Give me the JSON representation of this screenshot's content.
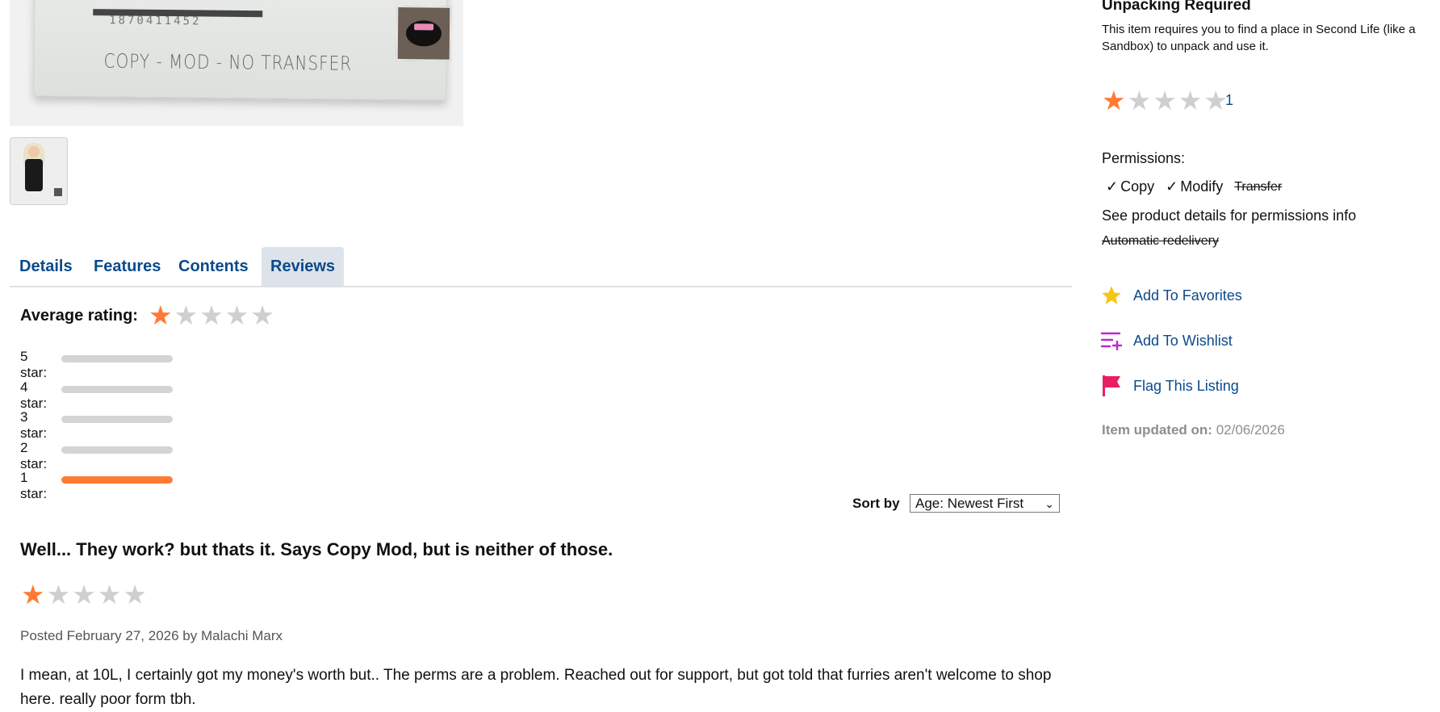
{
  "product_image": {
    "barcode_text": "1870411452",
    "label_text": "COPY - MOD - NO TRANSFER"
  },
  "tabs": [
    {
      "label": "Details"
    },
    {
      "label": "Features"
    },
    {
      "label": "Contents"
    },
    {
      "label": "Reviews",
      "active": true
    }
  ],
  "average_rating": {
    "label": "Average rating:",
    "stars_filled": 1,
    "stars_total": 5
  },
  "distribution": [
    {
      "label": "5 star:",
      "fraction": 0
    },
    {
      "label": "4 star:",
      "fraction": 0
    },
    {
      "label": "3 star:",
      "fraction": 0
    },
    {
      "label": "2 star:",
      "fraction": 0
    },
    {
      "label": "1 star:",
      "fraction": 1
    }
  ],
  "sort": {
    "label": "Sort by",
    "selected": "Age: Newest First"
  },
  "review": {
    "title": "Well... They work? but thats it. Says Copy Mod, but is neither of those.",
    "stars_filled": 1,
    "meta": "Posted February 27, 2026 by Malachi Marx",
    "body": "I mean, at 10L, I certainly got my money's worth but.. The perms are a problem. Reached out for support, but got told that furries aren't welcome to shop here. really poor form tbh."
  },
  "sidebar": {
    "unpack_title": "Unpacking Required",
    "unpack_text": "This item requires you to find a place in Second Life (like a Sandbox) to unpack and use it.",
    "rating_stars_filled": 1,
    "rating_count": "1",
    "permissions_label": "Permissions:",
    "perm_copy": "Copy",
    "perm_modify": "Modify",
    "perm_transfer": "Transfer",
    "perm_info": "See product details for permissions info",
    "redelivery": "Automatic redelivery",
    "add_favorites": "Add To Favorites",
    "add_wishlist": "Add To Wishlist",
    "flag_listing": "Flag This Listing",
    "updated_label": "Item updated on:",
    "updated_date": "02/06/2026"
  },
  "colors": {
    "link": "#0b4a8b",
    "star_on": "#ff7a33",
    "star_off": "#cfcfcf",
    "wishlist": "#c026d3",
    "flag": "#e91e63",
    "favorite": "#f5c518"
  }
}
